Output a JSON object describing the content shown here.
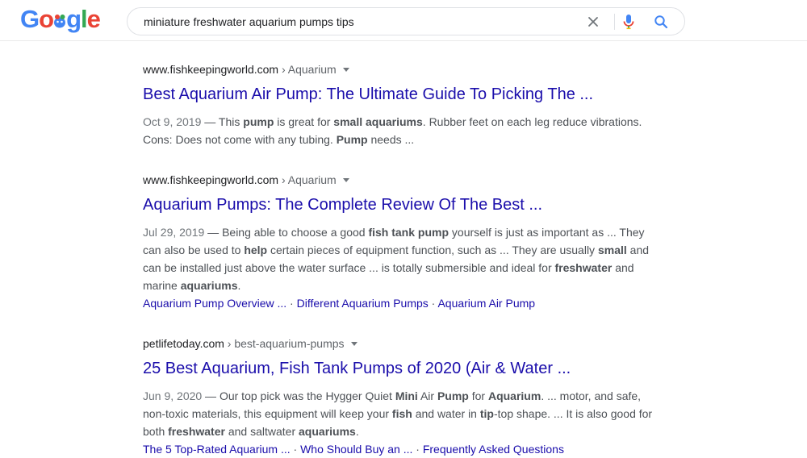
{
  "logo": {
    "text": "Google"
  },
  "search": {
    "query": "miniature freshwater aquarium pumps tips"
  },
  "icons": {
    "clear": "close-icon",
    "mic": "microphone-icon",
    "search": "search-icon",
    "caret": "caret-down-icon"
  },
  "colors": {
    "link": "#1a0dab",
    "snippet": "#4d5156",
    "date": "#70757a",
    "logo_blue": "#4285f4",
    "logo_red": "#ea4335",
    "logo_green": "#34a853",
    "mic_red": "#ea4335",
    "search_blue": "#4285f4"
  },
  "results": [
    {
      "domain": "www.fishkeepingworld.com",
      "breadcrumb": " › Aquarium",
      "title": "Best Aquarium Air Pump: The Ultimate Guide To Picking The ...",
      "snippet": [
        {
          "t": "Oct 9, 2019",
          "s": "date"
        },
        {
          "t": " — This ",
          "s": ""
        },
        {
          "t": "pump",
          "s": "b"
        },
        {
          "t": " is great for ",
          "s": ""
        },
        {
          "t": "small aquariums",
          "s": "b"
        },
        {
          "t": ". Rubber feet on each leg reduce vibrations. Cons: Does not come with any tubing. ",
          "s": ""
        },
        {
          "t": "Pump",
          "s": "b"
        },
        {
          "t": " needs ...",
          "s": ""
        }
      ],
      "sitelinks": []
    },
    {
      "domain": "www.fishkeepingworld.com",
      "breadcrumb": " › Aquarium",
      "title": "Aquarium Pumps: The Complete Review Of The Best ...",
      "snippet": [
        {
          "t": "Jul 29, 2019",
          "s": "date"
        },
        {
          "t": " — Being able to choose a good ",
          "s": ""
        },
        {
          "t": "fish tank pump",
          "s": "b"
        },
        {
          "t": " yourself is just as important as ... They can also be used to ",
          "s": ""
        },
        {
          "t": "help",
          "s": "b"
        },
        {
          "t": " certain pieces of equipment function, such as ... They are usually ",
          "s": ""
        },
        {
          "t": "small",
          "s": "b"
        },
        {
          "t": " and can be installed just above the water surface ... is totally submersible and ideal for ",
          "s": ""
        },
        {
          "t": "freshwater",
          "s": "b"
        },
        {
          "t": " and marine ",
          "s": ""
        },
        {
          "t": "aquariums",
          "s": "b"
        },
        {
          "t": ".",
          "s": ""
        }
      ],
      "sitelinks": [
        "Aquarium Pump Overview ...",
        "Different Aquarium Pumps",
        "Aquarium Air Pump"
      ]
    },
    {
      "domain": "petlifetoday.com",
      "breadcrumb": " › best-aquarium-pumps",
      "title": "25 Best Aquarium, Fish Tank Pumps of 2020 (Air & Water ...",
      "snippet": [
        {
          "t": "Jun 9, 2020",
          "s": "date"
        },
        {
          "t": " — Our top pick was the Hygger Quiet ",
          "s": ""
        },
        {
          "t": "Mini",
          "s": "b"
        },
        {
          "t": " Air ",
          "s": ""
        },
        {
          "t": "Pump",
          "s": "b"
        },
        {
          "t": " for ",
          "s": ""
        },
        {
          "t": "Aquarium",
          "s": "b"
        },
        {
          "t": ". ... motor, and safe, non-toxic materials, this equipment will keep your ",
          "s": ""
        },
        {
          "t": "fish",
          "s": "b"
        },
        {
          "t": " and water in ",
          "s": ""
        },
        {
          "t": "tip",
          "s": "b"
        },
        {
          "t": "-top shape. ... It is also good for both ",
          "s": ""
        },
        {
          "t": "freshwater",
          "s": "b"
        },
        {
          "t": " and saltwater ",
          "s": ""
        },
        {
          "t": "aquariums",
          "s": "b"
        },
        {
          "t": ".",
          "s": ""
        }
      ],
      "sitelinks": [
        "The 5 Top-Rated Aquarium ...",
        "Who Should Buy an ...",
        "Frequently Asked Questions"
      ]
    }
  ]
}
